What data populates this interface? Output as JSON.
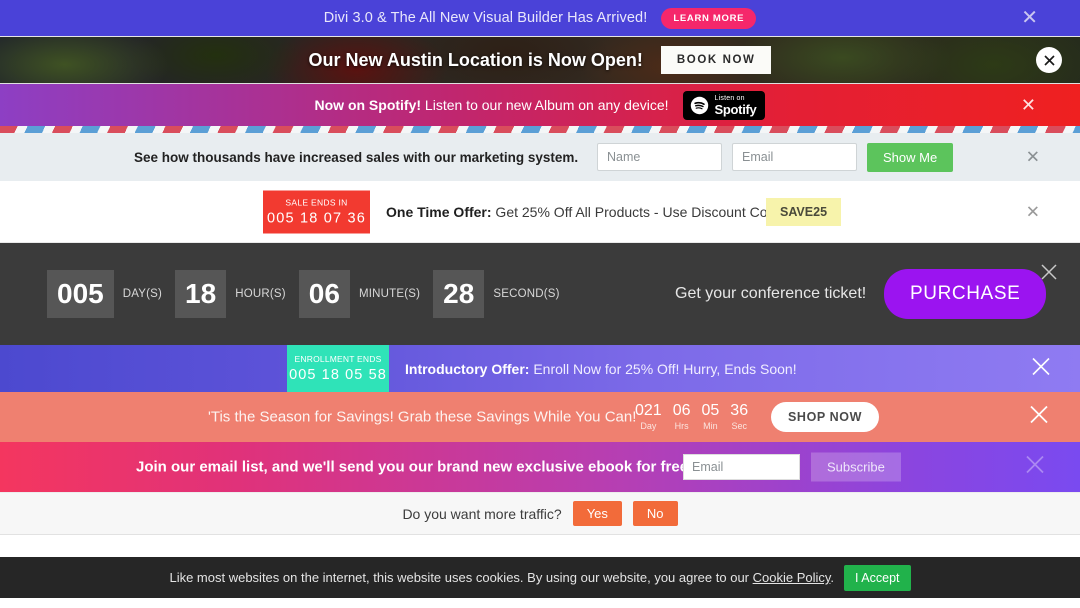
{
  "divi_bar": {
    "message": "Divi 3.0 & The All New Visual Builder Has Arrived!",
    "cta_label": "LEARN MORE",
    "close_label": "✕",
    "bg_color": "#4a42d8",
    "cta_color": "#f5276b"
  },
  "austin_bar": {
    "message": "Our New Austin Location is Now Open!",
    "cta_label": "BOOK NOW",
    "close_icon": "close-icon"
  },
  "spotify_bar": {
    "message_bold": "Now on Spotify!",
    "message_rest": " Listen to our new Album on any device!",
    "badge_small": "Listen on",
    "badge_big": "Spotify",
    "close_label": "✕"
  },
  "marketing_bar": {
    "message": "See how thousands have increased sales with our marketing system.",
    "name_placeholder": "Name",
    "name_value": "",
    "email_placeholder": "Email",
    "email_value": "",
    "submit_label": "Show Me",
    "submit_color": "#5cc45c",
    "close_label": "✕"
  },
  "one_time_offer": {
    "badge_label": "SALE ENDS IN",
    "badge_time": "005 18 07 36",
    "badge_color": "#f23a30",
    "message_bold": "One Time Offer:",
    "message_rest": " Get 25% Off All Products - Use Discount Code:",
    "code": "SAVE25",
    "code_color": "#f7f3ab",
    "close_label": "✕"
  },
  "conference_bar": {
    "countdown": [
      {
        "value": "005",
        "label": "DAY(S)"
      },
      {
        "value": "18",
        "label": "HOUR(S)"
      },
      {
        "value": "06",
        "label": "MINUTE(S)"
      },
      {
        "value": "28",
        "label": "SECOND(S)"
      }
    ],
    "message": "Get your conference ticket!",
    "cta_label": "PURCHASE",
    "cta_color": "#9b14f0",
    "bg_color": "#3b3b3b",
    "close_icon": "close-icon"
  },
  "intro_offer_bar": {
    "badge_label": "ENROLLMENT ENDS",
    "badge_time": "005 18 05 58",
    "badge_color": "#2fe3b8",
    "message_bold": "Introductory Offer:",
    "message_rest": " Enroll Now for 25% Off! Hurry, Ends Soon!",
    "close_icon": "close-icon"
  },
  "season_bar": {
    "message": "'Tis the Season for Savings! Grab these Savings While You Can!",
    "countdown": [
      {
        "value": "021",
        "label": "Day"
      },
      {
        "value": "06",
        "label": "Hrs"
      },
      {
        "value": "05",
        "label": "Min"
      },
      {
        "value": "36",
        "label": "Sec"
      }
    ],
    "cta_label": "SHOP NOW",
    "bg_color": "#ef8070",
    "close_icon": "close-icon"
  },
  "email_bar": {
    "message": "Join our email list, and we'll send you our brand new exclusive ebook for free!",
    "email_placeholder": "Email",
    "email_value": "",
    "submit_label": "Subscribe",
    "close_icon": "close-icon"
  },
  "traffic_bar": {
    "question": "Do you want more traffic?",
    "yes_label": "Yes",
    "no_label": "No",
    "button_color": "#f26b3a"
  },
  "cookie_bar": {
    "message_before": "Like most websites on the internet, this website uses cookies. By using our website, you agree to our ",
    "link_label": "Cookie Policy",
    "message_after": ".",
    "accept_label": "I Accept",
    "accept_color": "#21b24b",
    "bg_color": "#262626"
  }
}
